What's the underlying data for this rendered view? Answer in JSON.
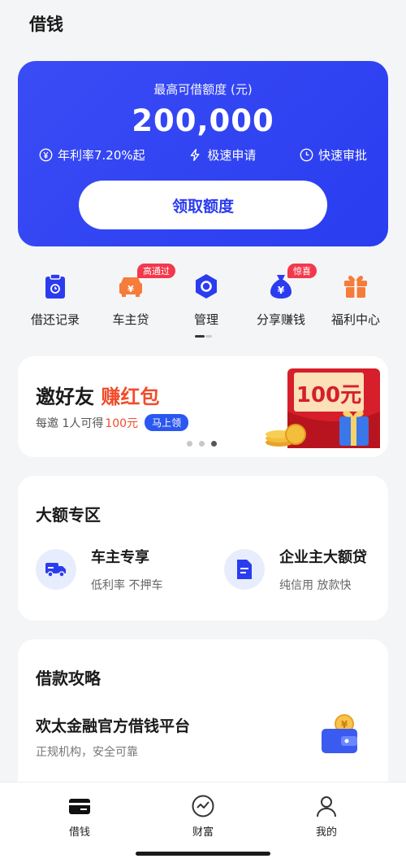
{
  "header": {
    "title": "借钱"
  },
  "hero": {
    "label": "最高可借额度 (元)",
    "amount": "200,000",
    "features": [
      "年利率7.20%起",
      "极速申请",
      "快速审批"
    ],
    "button": "领取额度"
  },
  "quick": [
    {
      "label": "借还记录",
      "icon": "calendar-clipboard-icon"
    },
    {
      "label": "车主贷",
      "icon": "car-icon",
      "badge": "高通过"
    },
    {
      "label": "管理",
      "icon": "hexagon-settings-icon"
    },
    {
      "label": "分享赚钱",
      "icon": "money-bag-icon",
      "badge": "惊喜"
    },
    {
      "label": "福利中心",
      "icon": "gift-icon"
    }
  ],
  "banner": {
    "title_main": "邀好友",
    "title_highlight": "赚红包",
    "sub_text": "每邀 1人可得",
    "sub_amount": "100元",
    "cta": "马上领",
    "envelope_text": "100元"
  },
  "big_amount": {
    "title": "大额专区",
    "products": [
      {
        "name": "车主专享",
        "desc": "低利率 不押车",
        "icon": "truck-icon"
      },
      {
        "name": "企业主大额贷",
        "desc": "纯信用 放款快",
        "icon": "document-icon"
      }
    ]
  },
  "guide": {
    "title": "借款攻略",
    "item_title": "欢太金融官方借钱平台",
    "item_sub": "正规机构，安全可靠"
  },
  "tabs": [
    {
      "label": "借钱",
      "icon": "wallet-icon",
      "active": true
    },
    {
      "label": "财富",
      "icon": "chart-circle-icon",
      "active": false
    },
    {
      "label": "我的",
      "icon": "profile-icon",
      "active": false
    }
  ],
  "colors": {
    "primary": "#2b3cf0",
    "accent_red": "#f24c2b",
    "badge_red": "#f2394b",
    "orange": "#f57c3b"
  }
}
